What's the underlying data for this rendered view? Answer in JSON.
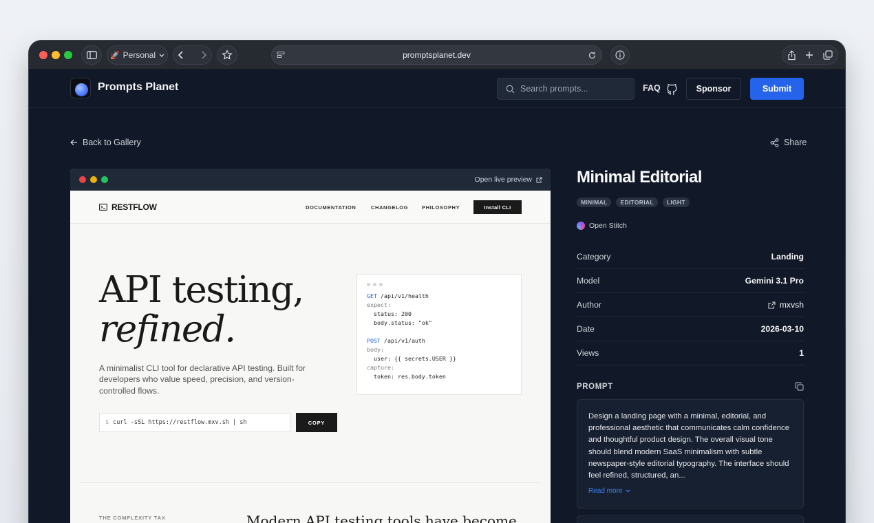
{
  "browser": {
    "profile_label": "Personal",
    "url": "promptsplanet.dev"
  },
  "site": {
    "name": "Prompts Planet",
    "search_placeholder": "Search prompts...",
    "faq": "FAQ",
    "sponsor": "Sponsor",
    "submit": "Submit",
    "back": "Back to Gallery",
    "share": "Share"
  },
  "preview": {
    "open_live": "Open live preview",
    "brand": "RESTFLOW",
    "nav": [
      "DOCUMENTATION",
      "CHANGELOG",
      "PHILOSOPHY"
    ],
    "cta": "Install CLI",
    "hero_line1": "API testing,",
    "hero_line2": "refined.",
    "description": "A minimalist CLI tool for declarative API testing. Built for developers who value speed, precision, and version-controlled flows.",
    "prompt_symbol": "$",
    "command": "curl -sSL https://restflow.mxv.sh | sh",
    "copy": "COPY",
    "section_label": "THE COMPLEXITY TAX",
    "section_heading": "Modern API testing tools have become"
  },
  "detail": {
    "title": "Minimal Editorial",
    "tags": [
      "MINIMAL",
      "EDITORIAL",
      "LIGHT"
    ],
    "tool": "Open Stitch",
    "meta": [
      {
        "key": "Category",
        "value": "Landing"
      },
      {
        "key": "Model",
        "value": "Gemini 3.1 Pro"
      },
      {
        "key": "Author",
        "value": "mxvsh"
      },
      {
        "key": "Date",
        "value": "2026-03-10"
      },
      {
        "key": "Views",
        "value": "1"
      }
    ],
    "prompt_label": "PROMPT",
    "prompt_text": "Design a landing page with a minimal, editorial, and professional aesthetic that communicates calm confidence and thoughtful product design. The overall visual tone should blend modern SaaS minimalism with subtle newspaper-style editorial typography. The interface should feel refined, structured, an...",
    "read_more": "Read more"
  },
  "colors": {
    "accent": "#2563eb",
    "background": "#111827",
    "panel": "#172031"
  }
}
